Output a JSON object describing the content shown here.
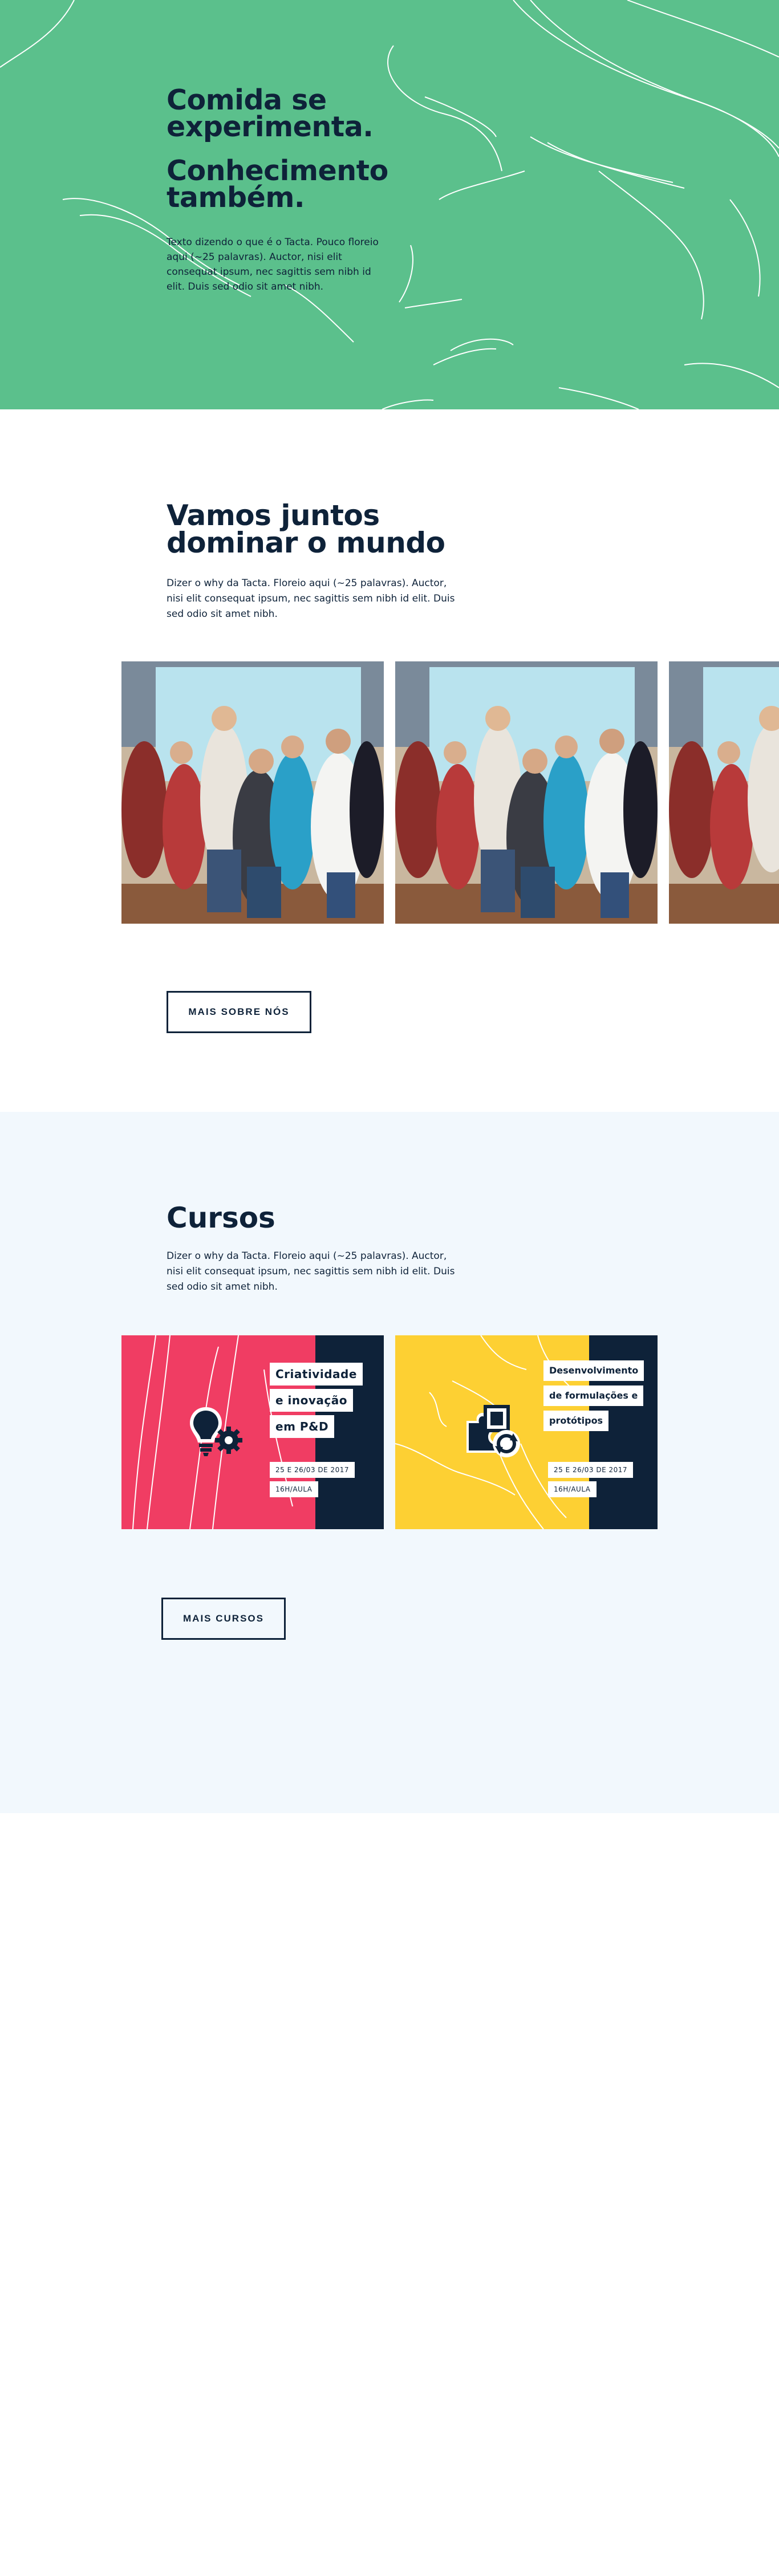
{
  "hero": {
    "title_line1": "Comida se experimenta.",
    "title_line2": "Conhecimento também.",
    "description": "Texto dizendo o que é o Tacta. Pouco floreio aqui (~25 palavras). Auctor, nisi elit consequat ipsum, nec sagittis sem nibh id elit. Duis sed odio sit amet nibh.",
    "bg_color": "#5bc08c"
  },
  "about": {
    "title": "Vamos juntos dominar o mundo",
    "description": "Dizer o why da Tacta. Floreio aqui (~25 palavras). Auctor, nisi elit consequat ipsum, nec sagittis sem nibh id elit. Duis sed odio sit amet nibh.",
    "button_label": "MAIS SOBRE NÓS"
  },
  "courses": {
    "title": "Cursos",
    "description": "Dizer o why da Tacta. Floreio aqui (~25 palavras). Auctor, nisi elit consequat ipsum, nec sagittis sem nibh id elit. Duis sed odio sit amet nibh.",
    "button_label": "MAIS CURSOS",
    "bg_color": "#f2f8fd",
    "cards": [
      {
        "title_lines": [
          "Criatividade",
          "e inovação",
          "em P&D"
        ],
        "date": "25 E 26/03 DE 2017",
        "hours": "16H/AULA",
        "color": "#f03d63",
        "icon": "lightbulb-gear-icon"
      },
      {
        "title_lines": [
          "Desenvolvimento",
          "de formulações e",
          "protótipos"
        ],
        "date": "25 E 26/03 DE 2017",
        "hours": "16H/AULA",
        "color": "#fdd033",
        "icon": "puzzle-refresh-icon"
      }
    ]
  },
  "colors": {
    "navy": "#0e2239"
  }
}
